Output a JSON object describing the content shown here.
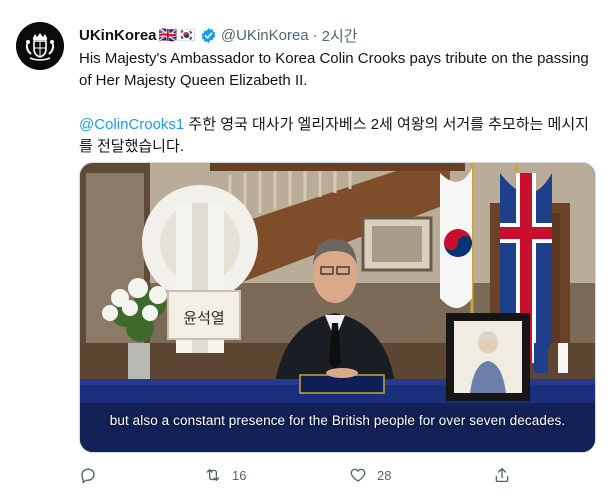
{
  "tweet": {
    "display_name": "UKinKorea",
    "flags": "🇬🇧🇰🇷",
    "handle": "@UKinKorea",
    "separator": "·",
    "time": "2시간",
    "text_line1": "His Majesty's Ambassador to Korea Colin Crooks pays tribute on the passing of Her Majesty Queen Elizabeth II.",
    "mention": "@ColinCrooks1",
    "text_korean": " 주한 영국 대사가 엘리자베스 2세 여왕의 서거를 추모하는 메시지를 전달했습니다."
  },
  "media": {
    "subtitle": "but also a constant presence for the British people for over seven decades.",
    "sign_text": "윤석열"
  },
  "actions": {
    "reply_icon": "reply-icon",
    "reply_count": "",
    "retweet_icon": "retweet-icon",
    "retweet_count": "16",
    "like_icon": "heart-icon",
    "like_count": "28",
    "share_icon": "share-icon"
  },
  "colors": {
    "accent": "#1d9bf0",
    "text": "#0f1419",
    "muted": "#536471"
  }
}
